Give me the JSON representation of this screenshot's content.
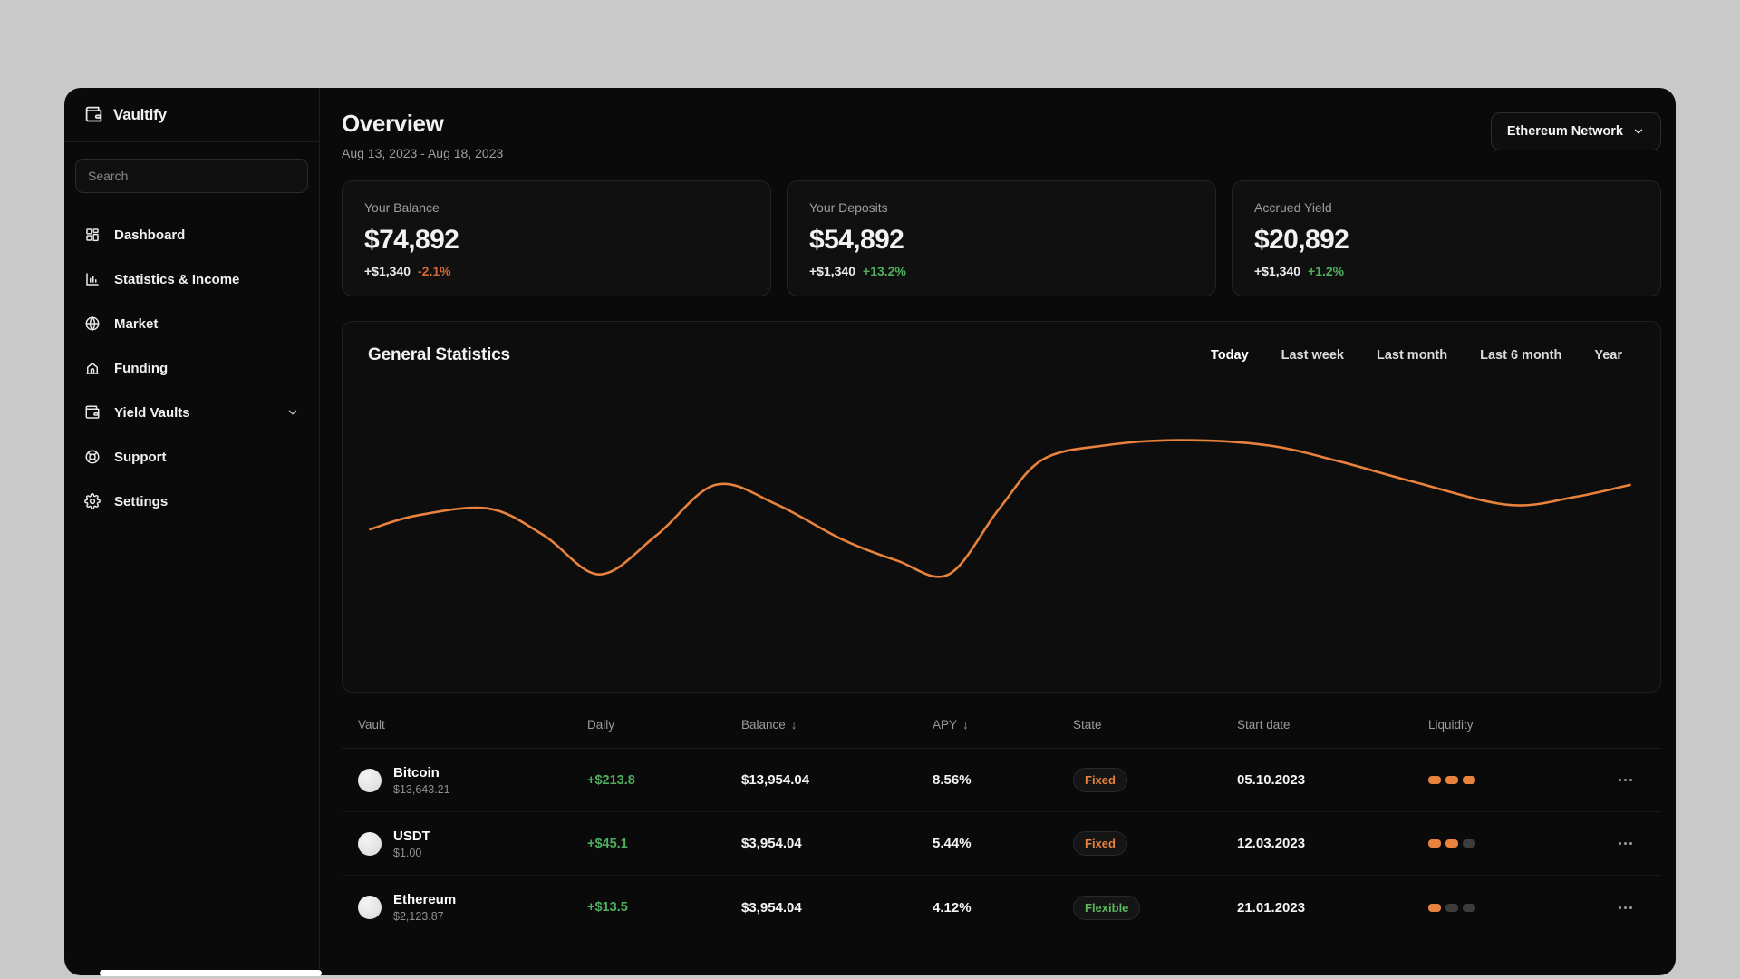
{
  "colors": {
    "accent_orange": "#e8823c",
    "negative_orange": "#cf6a35",
    "positive_green": "#4fae5e",
    "pill_inactive": "#3c3c3c"
  },
  "icons": {
    "sort_desc": "↓"
  },
  "sidebar": {
    "logo": {
      "title": "Vaultify"
    },
    "search": {
      "placeholder": "Search"
    },
    "items": [
      {
        "label": "Dashboard"
      },
      {
        "label": "Statistics & Income"
      },
      {
        "label": "Market"
      },
      {
        "label": "Funding"
      },
      {
        "label": "Yield Vaults"
      },
      {
        "label": "Support"
      },
      {
        "label": "Settings"
      }
    ]
  },
  "header": {
    "title": "Overview",
    "date_range": "Aug 13, 2023 - Aug 18, 2023",
    "network_selector": "Ethereum Network"
  },
  "stat_cards": [
    {
      "label": "Your Balance",
      "value": "$74,892",
      "delta": "+$1,340",
      "pct": "-2.1%",
      "pct_style": "color:#cf6a35"
    },
    {
      "label": "Your Deposits",
      "value": "$54,892",
      "delta": "+$1,340",
      "pct": "+13.2%",
      "pct_style": "color:#4fae5e"
    },
    {
      "label": "Accrued Yield",
      "value": "$20,892",
      "delta": "+$1,340",
      "pct": "+1.2%",
      "pct_style": "color:#4fae5e"
    }
  ],
  "statistics": {
    "title": "General Statistics",
    "filters": [
      "Today",
      "Last week",
      "Last month",
      "Last 6 month",
      "Year"
    ],
    "line_color": "#e8823c"
  },
  "chart_data": {
    "type": "line",
    "title": "General Statistics",
    "axes_visible": false,
    "grid": false,
    "legend": false,
    "series": [
      {
        "name": "series-1",
        "color": "#e8823c",
        "points_pct": [
          [
            2.1,
            56.1
          ],
          [
            5.6,
            52.4
          ],
          [
            11.1,
            50.5
          ],
          [
            15.3,
            57.8
          ],
          [
            19.5,
            68.3
          ],
          [
            23.8,
            57.8
          ],
          [
            28.3,
            44.1
          ],
          [
            32.9,
            49.3
          ],
          [
            37.9,
            58.8
          ],
          [
            42.1,
            64.6
          ],
          [
            46.0,
            68.3
          ],
          [
            49.8,
            50.7
          ],
          [
            53.1,
            37.3
          ],
          [
            57.9,
            33.4
          ],
          [
            63.6,
            32.0
          ],
          [
            70.2,
            33.4
          ],
          [
            75.7,
            37.8
          ],
          [
            81.2,
            43.2
          ],
          [
            88.5,
            49.5
          ],
          [
            93.6,
            47.3
          ],
          [
            97.7,
            44.1
          ]
        ]
      }
    ]
  },
  "table": {
    "columns": {
      "vault": "Vault",
      "daily": "Daily",
      "balance": "Balance",
      "apy": "APY",
      "state": "State",
      "start_date": "Start date",
      "liquidity": "Liquidity"
    },
    "rows": [
      {
        "name": "Bitcoin",
        "price": "$13,643.21",
        "daily": "+$213.8",
        "balance": "$13,954.04",
        "apy": "8.56%",
        "state": "Fixed",
        "state_style": "color:#e8823c",
        "start_date": "05.10.2023",
        "pills": [
          "#e8823c",
          "#e8823c",
          "#e8823c"
        ]
      },
      {
        "name": "USDT",
        "price": "$1.00",
        "daily": "+$45.1",
        "balance": "$3,954.04",
        "apy": "5.44%",
        "state": "Fixed",
        "state_style": "color:#e8823c",
        "start_date": "12.03.2023",
        "pills": [
          "#e8823c",
          "#e8823c",
          "#3c3c3c"
        ]
      },
      {
        "name": "Ethereum",
        "price": "$2,123.87",
        "daily": "+$13.5",
        "balance": "$3,954.04",
        "apy": "4.12%",
        "state": "Flexible",
        "state_style": "color:#5cb85f",
        "start_date": "21.01.2023",
        "pills": [
          "#e8823c",
          "#3c3c3c",
          "#3c3c3c"
        ]
      }
    ]
  }
}
